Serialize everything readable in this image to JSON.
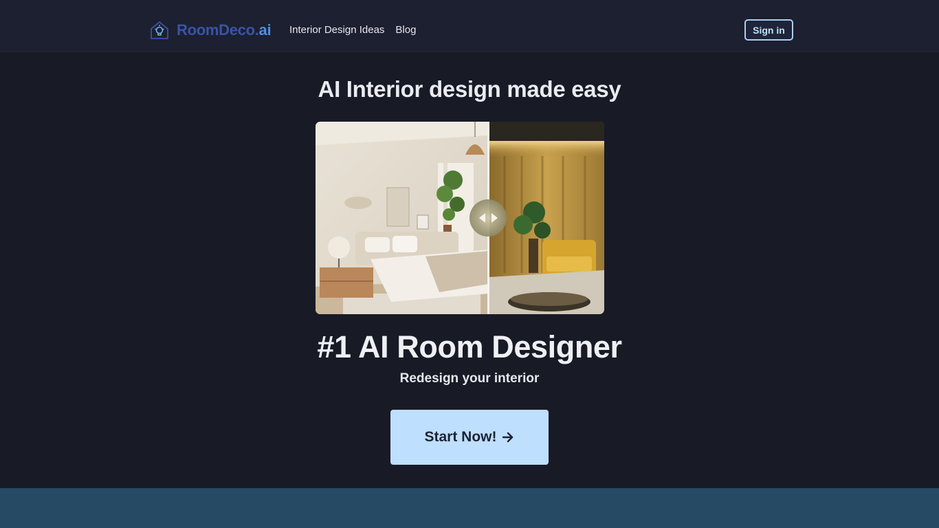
{
  "header": {
    "logo": {
      "main": "RoomDeco",
      "dot": ".",
      "ai": "ai",
      "icon": "house-bulb-icon"
    },
    "nav": [
      {
        "label": "Interior Design Ideas"
      },
      {
        "label": "Blog"
      }
    ],
    "signin_label": "Sign in"
  },
  "hero": {
    "tagline": "AI Interior design made easy",
    "image_alt": "Before and after room redesign comparison",
    "headline": "#1 AI Room Designer",
    "subhead": "Redesign your interior",
    "cta_label": "Start Now!",
    "cta_icon": "arrow-right-icon"
  },
  "colors": {
    "background": "#181b26",
    "header": "#1c2030",
    "accent": "#bfdffe",
    "logo_blue": "#3a53a8",
    "band": "#264a63"
  }
}
